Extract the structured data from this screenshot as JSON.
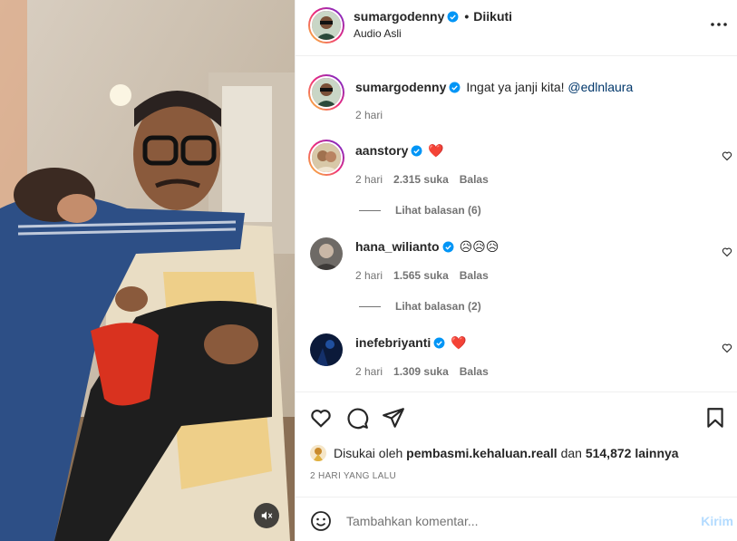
{
  "post": {
    "username": "sumargodenny",
    "follow_status": "Diikuti",
    "audio": "Audio Asli",
    "dot": "•"
  },
  "comments": [
    {
      "username": "sumargodenny",
      "text": "Ingat ya janji kita!",
      "mention": "@edlnlaura",
      "time": "2 hari"
    },
    {
      "username": "aanstory",
      "text": "❤️",
      "time": "2 hari",
      "likes": "2.315 suka",
      "reply": "Balas",
      "view_replies": "Lihat balasan (6)"
    },
    {
      "username": "hana_wilianto",
      "text": "😥😥😥",
      "time": "2 hari",
      "likes": "1.565 suka",
      "reply": "Balas",
      "view_replies": "Lihat balasan (2)"
    },
    {
      "username": "inefebriyanti",
      "text": "❤️",
      "time": "2 hari",
      "likes": "1.309 suka",
      "reply": "Balas"
    }
  ],
  "likes_line": {
    "prefix": "Disukai oleh",
    "liker": "pembasmi.kehaluan.reall",
    "middle": "dan",
    "count": "514,872 lainnya"
  },
  "posted_ago": "2 HARI YANG LALU",
  "add_comment": {
    "placeholder": "Tambahkan komentar...",
    "post_label": "Kirim"
  },
  "icons": {
    "verified": "verified-badge-icon",
    "like": "heart-icon",
    "comment": "comment-icon",
    "share": "send-icon",
    "save": "bookmark-icon",
    "emoji": "emoji-icon",
    "mute": "muted-speaker-icon",
    "more": "more-options-icon"
  },
  "colors": {
    "verified": "#0095f6",
    "heart_emoji": "#e0245e",
    "post_disabled": "#b3dbff",
    "mention": "#00376b"
  }
}
